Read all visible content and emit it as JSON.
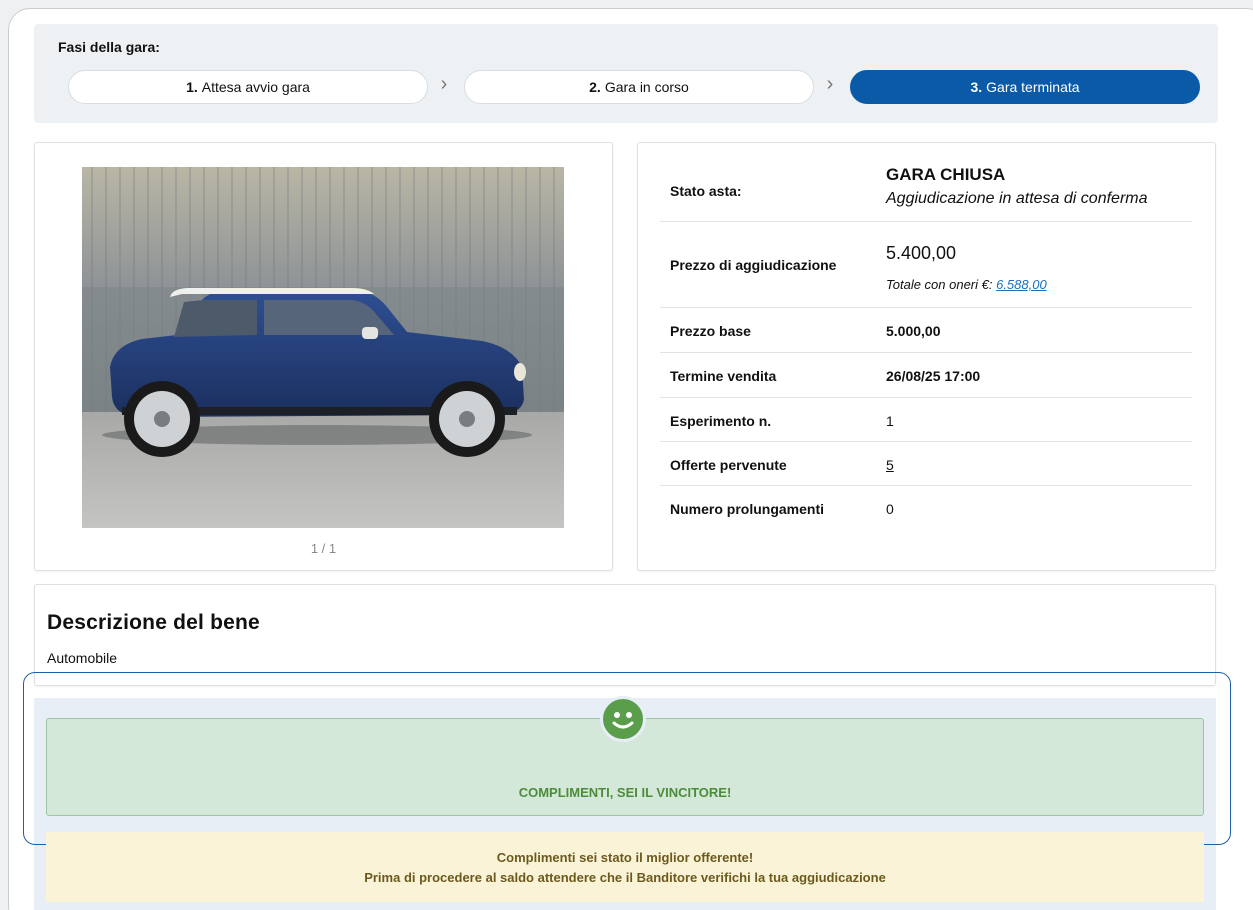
{
  "phases": {
    "title": "Fasi della gara:",
    "steps": [
      {
        "num": "1.",
        "label": "Attesa avvio gara"
      },
      {
        "num": "2.",
        "label": "Gara in corso"
      },
      {
        "num": "3.",
        "label": "Gara terminata"
      }
    ],
    "separator": "›"
  },
  "gallery": {
    "counter": "1 / 1"
  },
  "info": {
    "status_label": "Stato asta:",
    "status_value": "GARA CHIUSA",
    "status_sub": "Aggiudicazione in attesa di conferma",
    "price_label": "Prezzo di aggiudicazione",
    "price_value": "5.400,00",
    "price_total_label": "Totale con oneri €: ",
    "price_total_value": "6.588,00",
    "base_label": "Prezzo base",
    "base_value": "5.000,00",
    "end_label": "Termine vendita",
    "end_value": "26/08/25 17:00",
    "exp_label": "Esperimento n.",
    "exp_value": "1",
    "offers_label": "Offerte pervenute",
    "offers_value": "5",
    "ext_label": "Numero prolungamenti",
    "ext_value": "0"
  },
  "description": {
    "title": "Descrizione del bene",
    "text": "Automobile"
  },
  "result": {
    "icon": "smiley-icon",
    "winner": "COMPLIMENTI, SEI IL VINCITORE!",
    "notice_line1": "Complimenti sei stato il miglior offerente!",
    "notice_line2": "Prima di procedere al saldo attendere che il Banditore verifichi la tua aggiudicazione"
  },
  "colors": {
    "active_step": "#0b5aa8",
    "winner_bg": "#d3e8d8",
    "winner_text": "#4c8c3a",
    "notice_bg": "#fbf3d8",
    "link": "#1a6fbf"
  }
}
